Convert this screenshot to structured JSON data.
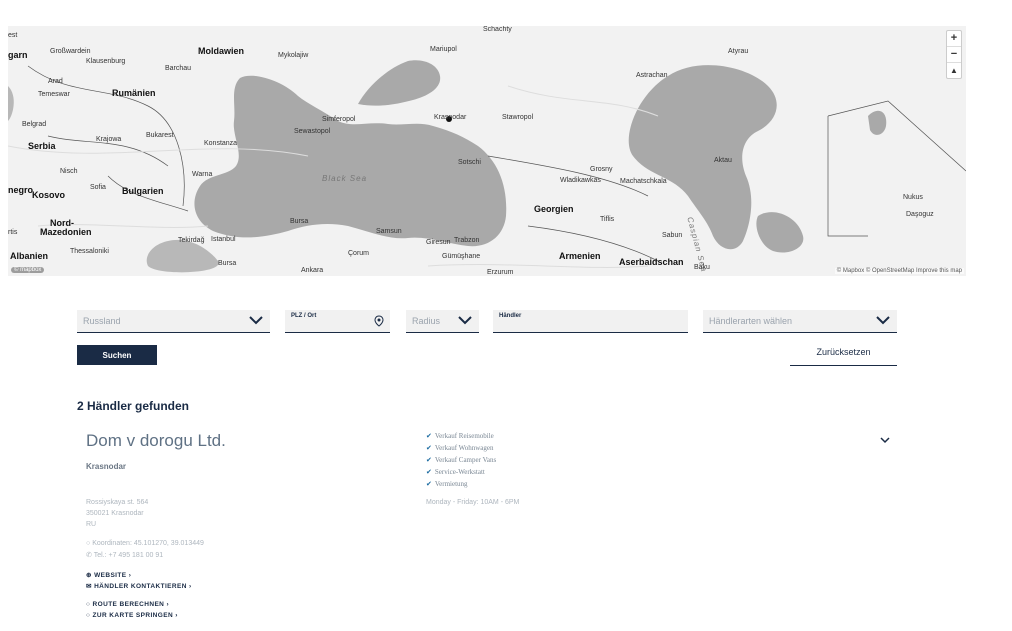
{
  "map": {
    "labels": {
      "ukraine_city": "Schachty",
      "moldawien": "Moldawien",
      "mykolajiw": "Mykolajiw",
      "mariupol": "Mariupol",
      "atyrau": "Atyrau",
      "garn": "garn",
      "grosswardein": "Großwardein",
      "klausenburg": "Klausenburg",
      "barchau": "Barchau",
      "astrachan": "Astrachan",
      "arad": "Arad",
      "temeswar": "Temeswar",
      "rumaenien": "Rumänien",
      "simferopol": "Simferopol",
      "krasnodar": "Krasnodar",
      "stawropol": "Stawropol",
      "belgrad": "Belgrad",
      "sewastopol": "Sewastopol",
      "serbia": "Serbia",
      "krajowa": "Krajowa",
      "bukarest": "Bukarest",
      "konstanza": "Konstanza",
      "aktau": "Aktau",
      "sotschi": "Sotschi",
      "grosny": "Grosny",
      "nisch": "Nisch",
      "black_sea": "Black Sea",
      "warna": "Warna",
      "wladikawkas": "Wladikawkas",
      "machatschkala": "Machatschkala",
      "kosovo": "Kosovo",
      "sofia": "Sofia",
      "bulgarien": "Bulgarien",
      "negro": "negro",
      "nukus": "Nukus",
      "georgien": "Georgien",
      "nord_mazedonien_1": "Nord-",
      "nord_mazedonien_2": "Mazedonien",
      "tiflis": "Tiflis",
      "dasoguz": "Daşoguz",
      "bursa_city": "Bursa",
      "tekirdag": "Tekirdağ",
      "istanbul": "Istanbul",
      "samsun": "Samsun",
      "giresun": "Giresun",
      "trabzon": "Trabzon",
      "sabun": "Sabun",
      "caspian_sea": "Caspian Sea",
      "albanien": "Albanien",
      "thessaloniki": "Thessaloniki",
      "corum": "Çorum",
      "gumushane": "Gümüşhane",
      "armenien": "Armenien",
      "aserbaidschan": "Aserbaidschan",
      "baku": "Baku",
      "bursa": "Bursa",
      "ankara": "Ankara",
      "erzurum": "Erzurum",
      "rtis": "rtis"
    },
    "zoom_in": "+",
    "zoom_out": "−",
    "compass": "▲",
    "attribution": "© Mapbox © OpenStreetMap  Improve this map",
    "logo": "© mapbox"
  },
  "filters": {
    "country_placeholder": "Russland",
    "plz_label": "PLZ / Ort",
    "radius_placeholder": "Radius",
    "haendler_label": "Händler",
    "types_placeholder": "Händlerarten wählen",
    "search_button": "Suchen",
    "reset_link": "Zurücksetzen"
  },
  "results": {
    "count_text": "2 Händler gefunden",
    "dealers": [
      {
        "name": "Dom v dorogu Ltd.",
        "city": "Krasnodar",
        "address_line1": "Rossiyskaya st. 564",
        "address_line2": "350021 Krasnodar",
        "address_line3": "RU",
        "coordinates": "Koordinaten: 45.101270, 39.013449",
        "phone": "Tel.: +7 495 181 00 91",
        "website_link": "WEBSITE",
        "contact_link": "HÄNDLER KONTAKTIEREN",
        "route_link": "ROUTE BERECHNEN",
        "map_link": "ZUR KARTE SPRINGEN",
        "features": [
          "Verkauf Reisemobile",
          "Verkauf Wohnwagen",
          "Verkauf Camper Vans",
          "Service-Werkstatt",
          "Vermietung"
        ],
        "hours": "Monday - Friday: 10AM - 6PM"
      }
    ]
  },
  "colors": {
    "accent": "#1a2b45",
    "water": "#a9a9a9",
    "land": "#f2f2f2"
  }
}
